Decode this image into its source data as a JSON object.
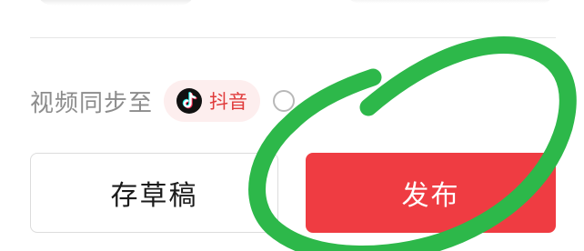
{
  "sync": {
    "label": "视频同步至",
    "platform_label": "抖音",
    "platform_icon": "douyin-logo-icon",
    "checked": false
  },
  "actions": {
    "draft_label": "存草稿",
    "publish_label": "发布"
  },
  "colors": {
    "publish_bg": "#ef3c42",
    "chip_bg": "#fdeeee",
    "chip_text": "#e03b3b",
    "annotation_stroke": "#2db84a"
  }
}
